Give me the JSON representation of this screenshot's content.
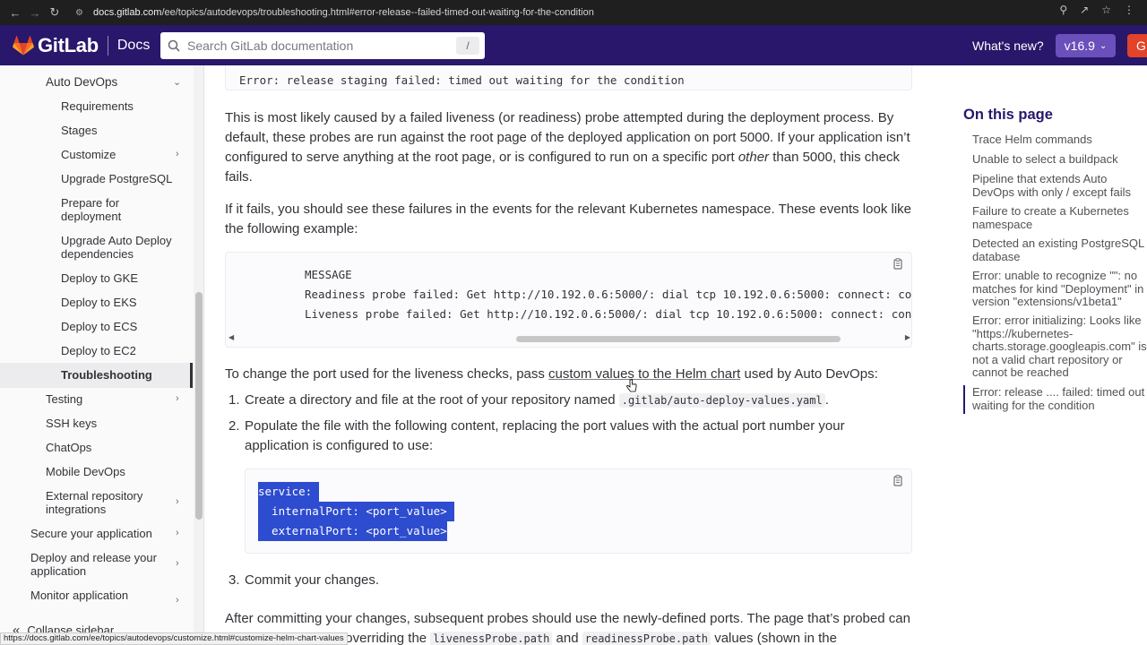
{
  "browser": {
    "url_host": "docs.gitlab.com",
    "url_path": "/ee/topics/autodevops/troubleshooting.html#error-release--failed-timed-out-waiting-for-the-condition",
    "status_url": "https://docs.gitlab.com/ee/topics/autodevops/customize.html#customize-helm-chart-values"
  },
  "header": {
    "brand": "GitLab",
    "section": "Docs",
    "search_placeholder": "Search GitLab documentation",
    "search_shortcut": "/",
    "whats_new": "What's new?",
    "version": "v16.9",
    "get_label": "G",
    "brand_color": "#28176b",
    "version_color": "#6b4fbb",
    "get_color": "#e24329"
  },
  "sidebar": {
    "parent": "Auto DevOps",
    "children": [
      "Requirements",
      "Stages",
      "Customize",
      "Upgrade PostgreSQL",
      "Prepare for deployment",
      "Upgrade Auto Deploy dependencies",
      "Deploy to GKE",
      "Deploy to EKS",
      "Deploy to ECS",
      "Deploy to EC2",
      "Troubleshooting"
    ],
    "siblings": [
      "Testing",
      "SSH keys",
      "ChatOps",
      "Mobile DevOps",
      "External repository integrations"
    ],
    "top": [
      "Secure your application",
      "Deploy and release your application",
      "Monitor application"
    ],
    "collapse": "Collapse sidebar"
  },
  "main": {
    "code_top": "Error: release staging failed: timed out waiting for the condition",
    "p1_a": "This is most likely caused by a failed liveness (or readiness) probe attempted during the deployment process. By default, these probes are run against the root page of the deployed application on port 5000. If your application isn’t configured to serve anything at the root page, or is configured to run on a specific port ",
    "p1_em": "other",
    "p1_b": " than 5000, this check fails.",
    "p2": "If it fails, you should see these failures in the events for the relevant Kubernetes namespace. These events look like the following example:",
    "code_lines": [
      "MESSAGE",
      "Readiness probe failed: Get http://10.192.0.6:5000/: dial tcp 10.192.0.6:5000: connect: connection refused",
      "Liveness probe failed: Get http://10.192.0.6:5000/: dial tcp 10.192.0.6:5000: connect: connection refused"
    ],
    "p3_a": "To change the port used for the liveness checks, pass ",
    "p3_link": "custom values to the Helm chart",
    "p3_b": " used by Auto DevOps:",
    "step1_num": "1.",
    "step1_a": "Create a directory and file at the root of your repository named ",
    "step1_code": ".gitlab/auto-deploy-values.yaml",
    "step1_b": ".",
    "step2_num": "2.",
    "step2": "Populate the file with the following content, replacing the port values with the actual port number your application is configured to use:",
    "yaml_lines": [
      "service:",
      "  internalPort: <port_value>",
      "  externalPort: <port_value>"
    ],
    "step3_num": "3.",
    "step3": "Commit your changes.",
    "p4_a": "After committing your changes, subsequent probes should use the newly-defined ports. The page that’s probed can also be changed by overriding the ",
    "p4_code1": "livenessProbe.path",
    "p4_and": " and ",
    "p4_code2": "readinessProbe.path",
    "p4_b": " values (shown in the"
  },
  "toc": {
    "title": "On this page",
    "items": [
      "Trace Helm commands",
      "Unable to select a buildpack",
      "Pipeline that extends Auto DevOps with only / except fails",
      "Failure to create a Kubernetes namespace",
      "Detected an existing PostgreSQL database",
      "Error: unable to recognize \"\": no matches for kind \"Deployment\" in version \"extensions/v1beta1\"",
      "Error: error initializing: Looks like \"https://kubernetes-charts.storage.googleapis.com\" is not a valid chart repository or cannot be reached",
      "Error: release .... failed: timed out waiting for the condition"
    ]
  }
}
